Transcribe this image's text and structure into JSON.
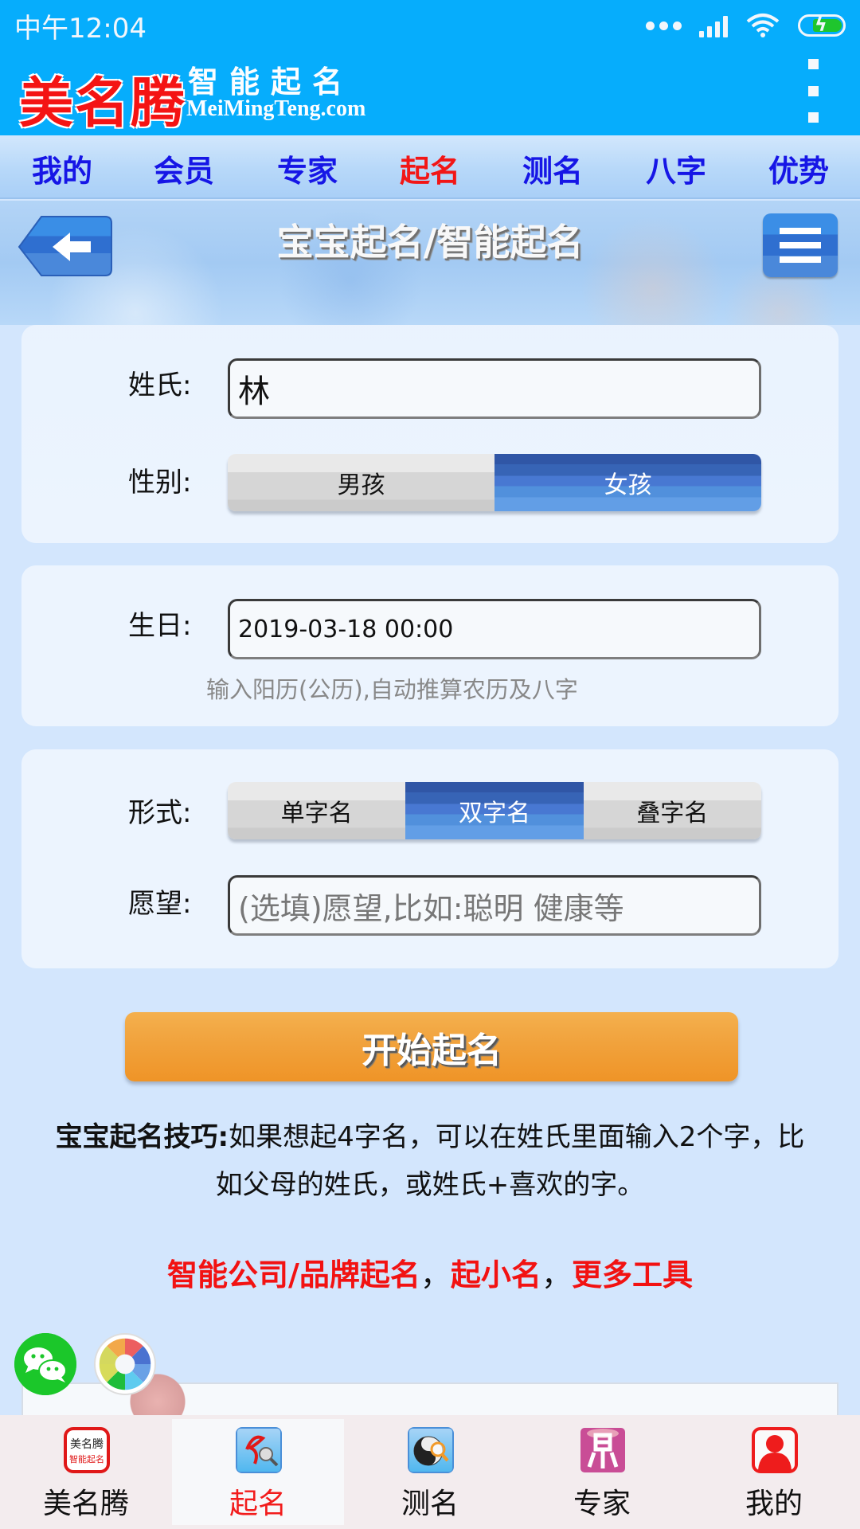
{
  "status_bar": {
    "time": "中午12:04",
    "battery_state": "charging"
  },
  "header": {
    "logo_mark": "美名腾",
    "logo_slogan": "智能起名",
    "logo_domain": "MeiMingTeng.com",
    "more_icon": "kebab-menu-icon"
  },
  "nav": {
    "items": [
      {
        "label": "我的"
      },
      {
        "label": "会员"
      },
      {
        "label": "专家"
      },
      {
        "label": "起名",
        "active": true
      },
      {
        "label": "测名"
      },
      {
        "label": "八字"
      },
      {
        "label": "优势"
      }
    ]
  },
  "title_bar": {
    "title": "宝宝起名/智能起名",
    "back_icon": "back-arrow-icon",
    "menu_icon": "hamburger-menu-icon"
  },
  "form": {
    "surname": {
      "label": "姓氏:",
      "value": "林"
    },
    "gender": {
      "label": "性别:",
      "options": [
        "男孩",
        "女孩"
      ],
      "selected": "女孩"
    },
    "birthday": {
      "label": "生日:",
      "value": "2019-03-18 00:00",
      "hint": "输入阳历(公历),自动推算农历及八字"
    },
    "name_form": {
      "label": "形式:",
      "options": [
        "单字名",
        "双字名",
        "叠字名"
      ],
      "selected": "双字名"
    },
    "wish": {
      "label": "愿望:",
      "value": "",
      "placeholder": "(选填)愿望,比如:聪明 健康等"
    },
    "submit_label": "开始起名"
  },
  "tip": {
    "heading": "宝宝起名技巧:",
    "body": "如果想起4字名，可以在姓氏里面输入2个字，比如父母的姓氏，或姓氏+喜欢的字。"
  },
  "links": {
    "items": [
      "智能公司/品牌起名",
      "起小名",
      "更多工具"
    ],
    "separator": "，"
  },
  "share": {
    "wechat_icon": "wechat-icon",
    "moments_icon": "wechat-moments-icon"
  },
  "tabbar": {
    "items": [
      {
        "label": "美名腾",
        "icon": "app-logo-icon"
      },
      {
        "label": "起名",
        "icon": "naming-icon",
        "active": true
      },
      {
        "label": "测名",
        "icon": "yin-yang-search-icon"
      },
      {
        "label": "专家",
        "icon": "expert-seal-icon"
      },
      {
        "label": "我的",
        "icon": "user-profile-icon"
      }
    ]
  },
  "colors": {
    "header_blue": "#06adfc",
    "nav_text": "#1616e6",
    "active_red": "#f21616",
    "segment_selected": "#4878d2",
    "start_button": "#f1a23c",
    "page_background": "#d3e6fd"
  }
}
